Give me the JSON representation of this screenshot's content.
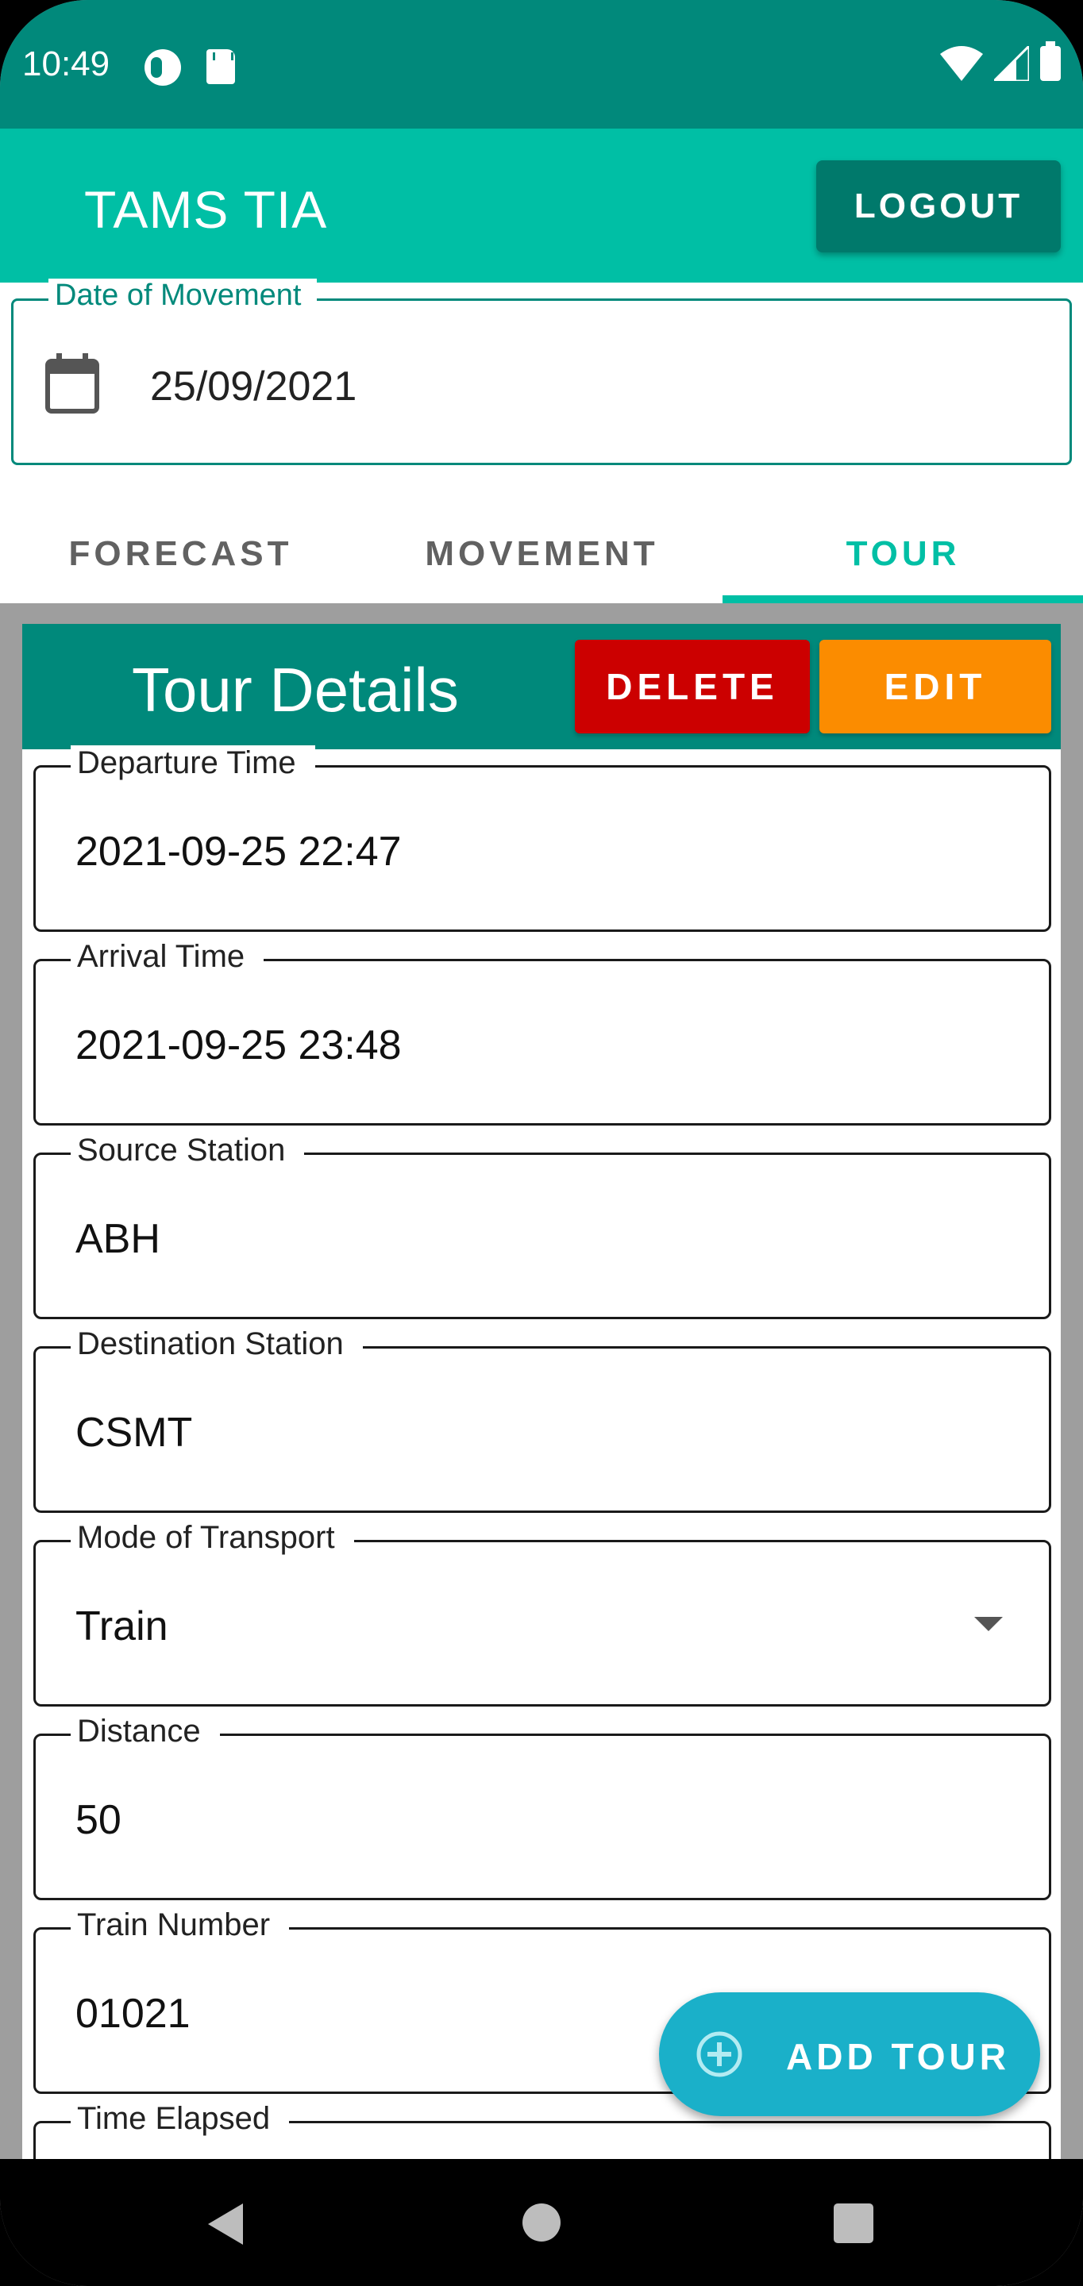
{
  "status_bar": {
    "time": "10:49",
    "icons": [
      "camera-icon",
      "sd-card-icon",
      "wifi-icon",
      "signal-icon",
      "battery-icon"
    ]
  },
  "app_bar": {
    "title": "TAMS TIA",
    "logout_label": "LOGOUT"
  },
  "date_field": {
    "label": "Date of Movement",
    "value": "25/09/2021",
    "icon": "calendar-icon"
  },
  "tabs": [
    {
      "label": "FORECAST",
      "selected": false
    },
    {
      "label": "MOVEMENT",
      "selected": false
    },
    {
      "label": "TOUR",
      "selected": true
    }
  ],
  "card": {
    "title": "Tour Details",
    "delete_label": "DELETE",
    "edit_label": "EDIT"
  },
  "fields": [
    {
      "label": "Departure Time",
      "value": "2021-09-25 22:47"
    },
    {
      "label": "Arrival Time",
      "value": "2021-09-25 23:48"
    },
    {
      "label": "Source Station",
      "value": "ABH"
    },
    {
      "label": "Destination Station",
      "value": "CSMT"
    },
    {
      "label": "Mode of Transport",
      "value": "Train"
    },
    {
      "label": "Distance",
      "value": "50"
    },
    {
      "label": "Train Number",
      "value": "01021"
    },
    {
      "label": "Time Elapsed",
      "value": ""
    }
  ],
  "fab": {
    "label": "ADD TOUR",
    "icon": "add-circle-icon"
  },
  "colors": {
    "status_bar": "#01897b",
    "app_bar": "#00bfa5",
    "accent": "#00bfa5",
    "card_header": "#00897b",
    "delete": "#cc0000",
    "edit": "#fb8c00",
    "fab": "#1ab0c9"
  }
}
